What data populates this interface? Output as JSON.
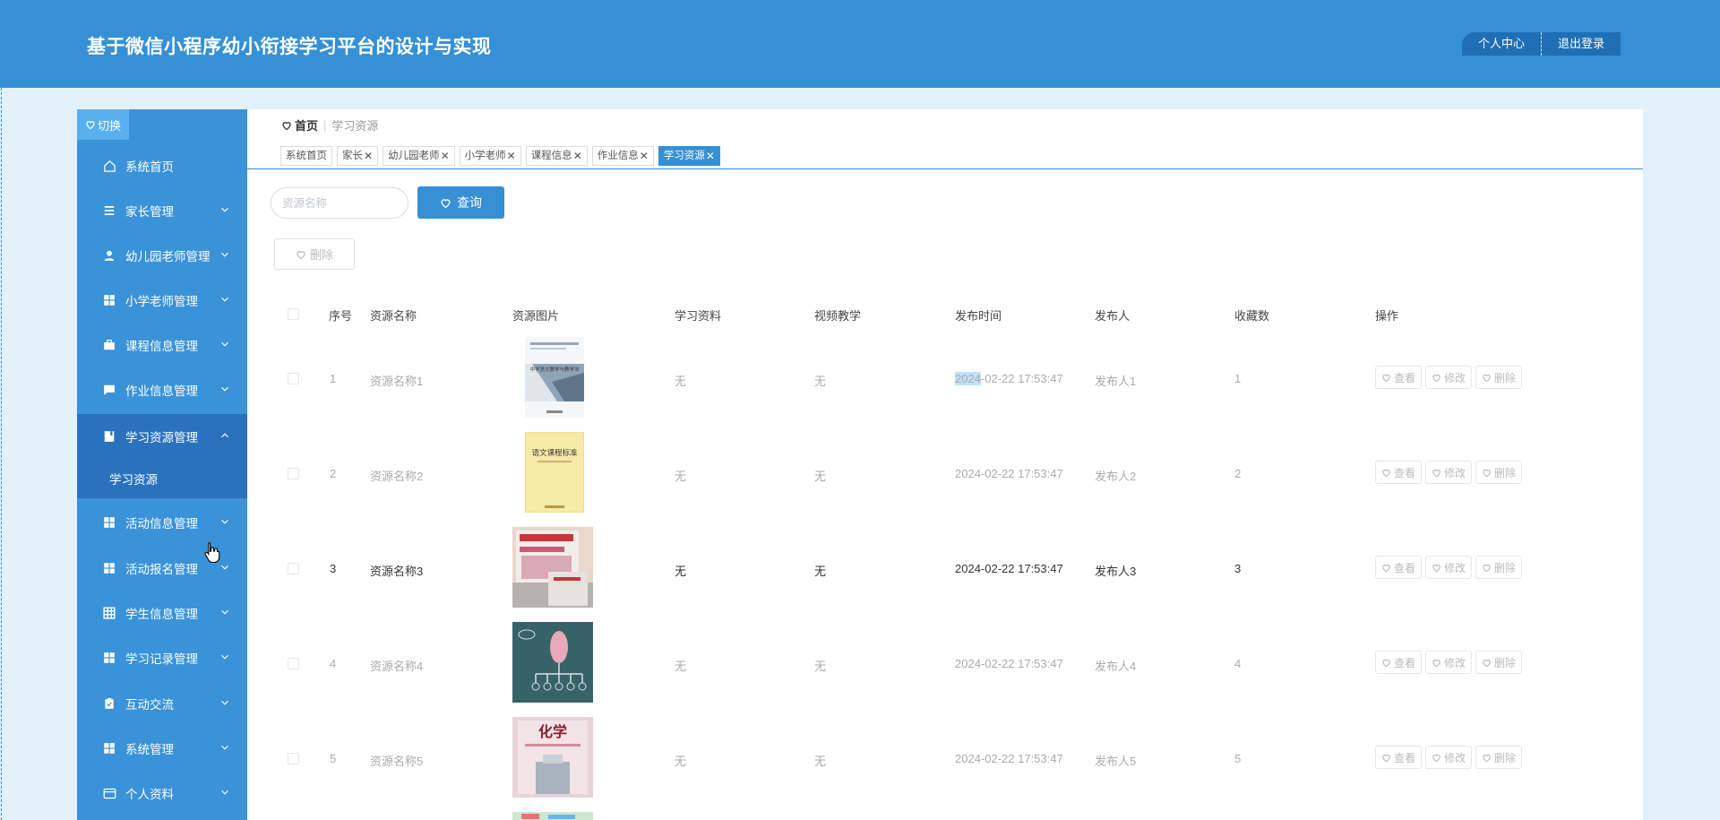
{
  "header": {
    "title": "基于微信小程序幼小衔接学习平台的设计与实现",
    "profile_label": "个人中心",
    "logout_label": "退出登录"
  },
  "sidebar": {
    "switch_label": "切换",
    "items": [
      {
        "label": "系统首页",
        "icon": "home-icon"
      },
      {
        "label": "家长管理",
        "icon": "list-icon"
      },
      {
        "label": "幼儿园老师管理",
        "icon": "user-icon"
      },
      {
        "label": "小学老师管理",
        "icon": "grid-icon"
      },
      {
        "label": "课程信息管理",
        "icon": "briefcase-icon"
      },
      {
        "label": "作业信息管理",
        "icon": "comment-icon"
      },
      {
        "label": "学习资源管理",
        "icon": "book-icon"
      },
      {
        "label": "活动信息管理",
        "icon": "grid-icon"
      },
      {
        "label": "活动报名管理",
        "icon": "grid-icon"
      },
      {
        "label": "学生信息管理",
        "icon": "table-icon"
      },
      {
        "label": "学习记录管理",
        "icon": "grid-icon"
      },
      {
        "label": "互动交流",
        "icon": "clipboard-icon"
      },
      {
        "label": "系统管理",
        "icon": "grid-icon"
      },
      {
        "label": "个人资料",
        "icon": "card-icon"
      }
    ],
    "submenu_label": "学习资源"
  },
  "breadcrumb": {
    "home": "首页",
    "separator": "|",
    "current": "学习资源"
  },
  "tabs": [
    {
      "label": "系统首页",
      "closable": false
    },
    {
      "label": "家长",
      "closable": true
    },
    {
      "label": "幼儿园老师",
      "closable": true
    },
    {
      "label": "小学老师",
      "closable": true
    },
    {
      "label": "课程信息",
      "closable": true
    },
    {
      "label": "作业信息",
      "closable": true
    },
    {
      "label": "学习资源",
      "closable": true
    }
  ],
  "search": {
    "placeholder": "资源名称",
    "query_label": "查询",
    "delete_label": "删除"
  },
  "table": {
    "headers": [
      "序号",
      "资源名称",
      "资源图片",
      "学习资料",
      "视频教学",
      "发布时间",
      "发布人",
      "收藏数",
      "操作"
    ],
    "rows": [
      {
        "index": "1",
        "name": "资源名称1",
        "material": "无",
        "video": "无",
        "time_year": "2024",
        "time_rest": "-02-22 17:53:47",
        "publisher": "发布人1",
        "favorites": "1"
      },
      {
        "index": "2",
        "name": "资源名称2",
        "material": "无",
        "video": "无",
        "time_year": "",
        "time_rest": "2024-02-22 17:53:47",
        "publisher": "发布人2",
        "favorites": "2"
      },
      {
        "index": "3",
        "name": "资源名称3",
        "material": "无",
        "video": "无",
        "time_year": "",
        "time_rest": "2024-02-22 17:53:47",
        "publisher": "发布人3",
        "favorites": "3"
      },
      {
        "index": "4",
        "name": "资源名称4",
        "material": "无",
        "video": "无",
        "time_year": "",
        "time_rest": "2024-02-22 17:53:47",
        "publisher": "发布人4",
        "favorites": "4"
      },
      {
        "index": "5",
        "name": "资源名称5",
        "material": "无",
        "video": "无",
        "time_year": "",
        "time_rest": "2024-02-22 17:53:47",
        "publisher": "发布人5",
        "favorites": "5"
      }
    ],
    "actions": {
      "view": "查看",
      "edit": "修改",
      "delete": "删除"
    }
  },
  "thumb_texts": {
    "book1_title": "中学语文教学与教学法",
    "book2_title": "语文课程标准",
    "book5_title": "化学"
  },
  "colors": {
    "header_bg": "#3590d6",
    "sidebar_bg": "#3a92d8",
    "sidebar_active": "#2a72be",
    "accent": "#3590d6",
    "page_bg": "#e3f1fb"
  }
}
